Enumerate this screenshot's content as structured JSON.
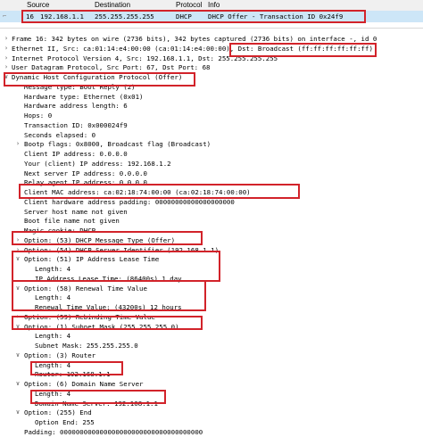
{
  "columns": {
    "source": "Source",
    "destination": "Destination",
    "protocol": "Protocol",
    "info": "Info"
  },
  "packet": {
    "no": "16",
    "source": "192.168.1.1",
    "destination": "255.255.255.255",
    "protocol": "DHCP",
    "info": "DHCP Offer    - Transaction ID 0x24f9"
  },
  "details": [
    {
      "indent": 0,
      "arrow": "collapsed",
      "text": "Frame 16: 342 bytes on wire (2736 bits), 342 bytes captured (2736 bits) on interface -, id 0"
    },
    {
      "indent": 0,
      "arrow": "collapsed",
      "text": "Ethernet II, Src: ca:01:14:e4:00:00 (ca:01:14:e4:00:00),",
      "highlight": "Dst: Broadcast (ff:ff:ff:ff:ff:ff)"
    },
    {
      "indent": 0,
      "arrow": "collapsed",
      "text": "Internet Protocol Version 4, Src: 192.168.1.1, Dst: 255.255.255.255"
    },
    {
      "indent": 0,
      "arrow": "collapsed",
      "text": "User Datagram Protocol, Src Port: 67, Dst Port: 68"
    },
    {
      "indent": 0,
      "arrow": "expanded",
      "text": "Dynamic Host Configuration Protocol (Offer)"
    },
    {
      "indent": 1,
      "arrow": "none",
      "text": "Message type: Boot Reply (2)"
    },
    {
      "indent": 1,
      "arrow": "none",
      "text": "Hardware type: Ethernet (0x01)"
    },
    {
      "indent": 1,
      "arrow": "none",
      "text": "Hardware address length: 6"
    },
    {
      "indent": 1,
      "arrow": "none",
      "text": "Hops: 0"
    },
    {
      "indent": 1,
      "arrow": "none",
      "text": "Transaction ID: 0x000024f9"
    },
    {
      "indent": 1,
      "arrow": "none",
      "text": "Seconds elapsed: 0"
    },
    {
      "indent": 1,
      "arrow": "collapsed",
      "text": "Bootp flags: 0x8000, Broadcast flag (Broadcast)"
    },
    {
      "indent": 1,
      "arrow": "none",
      "text": "Client IP address: 0.0.0.0"
    },
    {
      "indent": 1,
      "arrow": "none",
      "text": "Your (client) IP address: 192.168.1.2"
    },
    {
      "indent": 1,
      "arrow": "none",
      "text": "Next server IP address: 0.0.0.0"
    },
    {
      "indent": 1,
      "arrow": "none",
      "text": "Relay agent IP address: 0.0.0.0"
    },
    {
      "indent": 1,
      "arrow": "none",
      "text": "Client MAC address: ca:02:18:74:00:00 (ca:02:18:74:00:00)"
    },
    {
      "indent": 1,
      "arrow": "none",
      "text": "Client hardware address padding: 00000000000000000000"
    },
    {
      "indent": 1,
      "arrow": "none",
      "text": "Server host name not given"
    },
    {
      "indent": 1,
      "arrow": "none",
      "text": "Boot file name not given"
    },
    {
      "indent": 1,
      "arrow": "none",
      "text": "Magic cookie: DHCP"
    },
    {
      "indent": 1,
      "arrow": "collapsed",
      "text": "Option: (53) DHCP Message Type (Offer)"
    },
    {
      "indent": 1,
      "arrow": "collapsed",
      "text": "Option: (54) DHCP Server Identifier (192.168.1.1)"
    },
    {
      "indent": 1,
      "arrow": "expanded",
      "text": "Option: (51) IP Address Lease Time"
    },
    {
      "indent": 2,
      "arrow": "none",
      "text": "Length: 4"
    },
    {
      "indent": 2,
      "arrow": "none",
      "text": "IP Address Lease Time: (86400s) 1 day"
    },
    {
      "indent": 1,
      "arrow": "expanded",
      "text": "Option: (58) Renewal Time Value"
    },
    {
      "indent": 2,
      "arrow": "none",
      "text": "Length: 4"
    },
    {
      "indent": 2,
      "arrow": "none",
      "text": "Renewal Time Value: (43200s) 12 hours"
    },
    {
      "indent": 1,
      "arrow": "collapsed",
      "text": "Option: (59) Rebinding Time Value"
    },
    {
      "indent": 1,
      "arrow": "expanded",
      "text": "Option: (1) Subnet Mask (255.255.255.0)"
    },
    {
      "indent": 2,
      "arrow": "none",
      "text": "Length: 4"
    },
    {
      "indent": 2,
      "arrow": "none",
      "text": "Subnet Mask: 255.255.255.0"
    },
    {
      "indent": 1,
      "arrow": "expanded",
      "text": "Option: (3) Router"
    },
    {
      "indent": 2,
      "arrow": "none",
      "text": "Length: 4"
    },
    {
      "indent": 2,
      "arrow": "none",
      "text": "Router: 192.168.1.1"
    },
    {
      "indent": 1,
      "arrow": "expanded",
      "text": "Option: (6) Domain Name Server"
    },
    {
      "indent": 2,
      "arrow": "none",
      "text": "Length: 4"
    },
    {
      "indent": 2,
      "arrow": "none",
      "text": "Domain Name Server: 192.168.1.1"
    },
    {
      "indent": 1,
      "arrow": "expanded",
      "text": "Option: (255) End"
    },
    {
      "indent": 2,
      "arrow": "none",
      "text": "Option End: 255"
    },
    {
      "indent": 1,
      "arrow": "none",
      "text": "Padding: 000000000000000000000000000000000000"
    }
  ],
  "colors": {
    "highlight_box": "#d2232a",
    "selected_row": "#cde6f7"
  }
}
